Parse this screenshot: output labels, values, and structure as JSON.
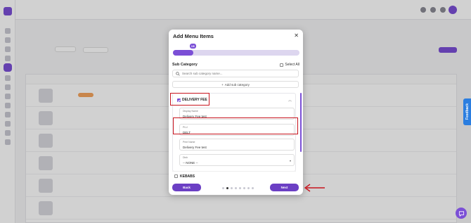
{
  "colors": {
    "accent": "#7b4fd6",
    "button": "#6b3fc4",
    "annotation": "#c8141e",
    "feedback": "#2b7ee0"
  },
  "modal": {
    "title": "Add Menu Items",
    "close_icon": "close-icon",
    "progress": {
      "percent": 16,
      "label": "1/6"
    },
    "sub_category_title": "Sub Category",
    "select_all_label": "Select All",
    "search_placeholder": "Search sub category name...",
    "add_sub_label": "Add sub category",
    "category": {
      "name": "DELIVERY FEE",
      "checked": true,
      "fields": [
        {
          "label": "Display Name",
          "value": "Delivery Fee test"
        },
        {
          "label": "PLU",
          "value": "DELT"
        },
        {
          "label": "Print Name",
          "value": "Delivery Fee test"
        },
        {
          "label": "Dish",
          "value": "-- NONE --"
        }
      ]
    },
    "next_category": {
      "name": "KEBABS",
      "checked": false
    },
    "back_label": "Back",
    "next_label": "Next",
    "pagination": {
      "total": 8,
      "active": 2
    }
  },
  "feedback_label": "Feedback"
}
